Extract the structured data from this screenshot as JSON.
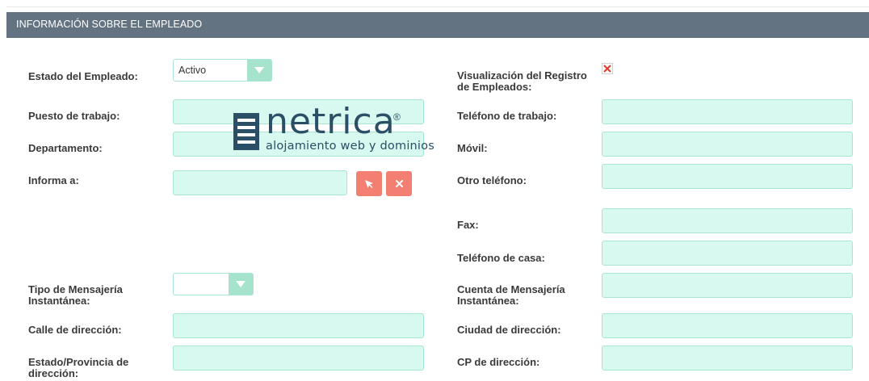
{
  "panel": {
    "title": "INFORMACIÓN SOBRE EL EMPLEADO"
  },
  "fields": {
    "estado_empleado": {
      "label": "Estado del Empleado:",
      "value": "Activo"
    },
    "visualizacion_registro": {
      "label": "Visualización del Registro de Empleados:",
      "checked": false
    },
    "puesto": {
      "label": "Puesto de trabajo:",
      "value": ""
    },
    "telefono_trabajo": {
      "label": "Teléfono de trabajo:",
      "value": ""
    },
    "departamento": {
      "label": "Departamento:",
      "value": ""
    },
    "movil": {
      "label": "Móvil:",
      "value": ""
    },
    "informa_a": {
      "label": "Informa a:",
      "value": ""
    },
    "otro_telefono": {
      "label": "Otro teléfono:",
      "value": ""
    },
    "fax": {
      "label": "Fax:",
      "value": ""
    },
    "telefono_casa": {
      "label": "Teléfono de casa:",
      "value": ""
    },
    "tipo_mensajeria": {
      "label": "Tipo de Mensajería Instantánea:",
      "value": ""
    },
    "cuenta_mensajeria": {
      "label": "Cuenta de Mensajería Instantánea:",
      "value": ""
    },
    "calle": {
      "label": "Calle de dirección:",
      "value": ""
    },
    "ciudad": {
      "label": "Ciudad de dirección:",
      "value": ""
    },
    "estado_provincia": {
      "label": "Estado/Provincia de dirección:",
      "value": ""
    },
    "cp": {
      "label": "CP de dirección:",
      "value": ""
    }
  },
  "watermark": {
    "brand": "netrica",
    "registered": "®",
    "tagline": "alojamiento web y dominios"
  },
  "colors": {
    "header_bg": "#637381",
    "input_bg": "#d7f9ef",
    "caret_bg": "#a5e3cd",
    "button_bg": "#f27f72",
    "brand": "#2a4f66"
  },
  "icons": {
    "select_caret": "caret-down-icon",
    "select_button": "cursor-arrow-icon",
    "clear_button": "close-icon",
    "checkbox_unchecked": "red-x-icon"
  }
}
